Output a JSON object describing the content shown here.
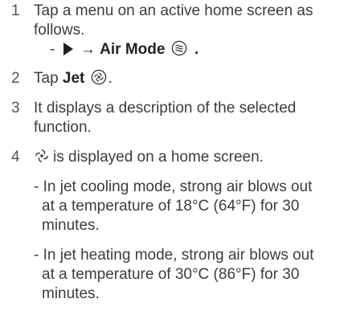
{
  "steps": [
    {
      "number": "1",
      "lines": [
        "Tap a menu on an active home screen as",
        "follows."
      ],
      "path": {
        "dash": "-",
        "arrow_icon": "play-triangle-icon",
        "arrow_symbol": "→",
        "menu_label": "Air Mode",
        "menu_icon": "air-mode-icon",
        "period": "."
      }
    },
    {
      "number": "2",
      "before": "Tap ",
      "bold": "Jet",
      "icon": "jet-icon",
      "period": "."
    },
    {
      "number": "3",
      "lines": [
        "It displays a description of the selected",
        "function."
      ]
    },
    {
      "number": "4",
      "icon": "jet-status-icon",
      "text": "is displayed on a home screen.",
      "bullets": [
        {
          "dash": "-",
          "lines": [
            "In jet cooling mode, strong air blows out",
            "at a temperature of 18°C (64°F) for 30",
            "minutes."
          ]
        },
        {
          "dash": "-",
          "lines": [
            "In jet heating mode, strong air blows out",
            "at a temperature of 30°C (86°F) for 30",
            "minutes."
          ]
        }
      ]
    }
  ]
}
